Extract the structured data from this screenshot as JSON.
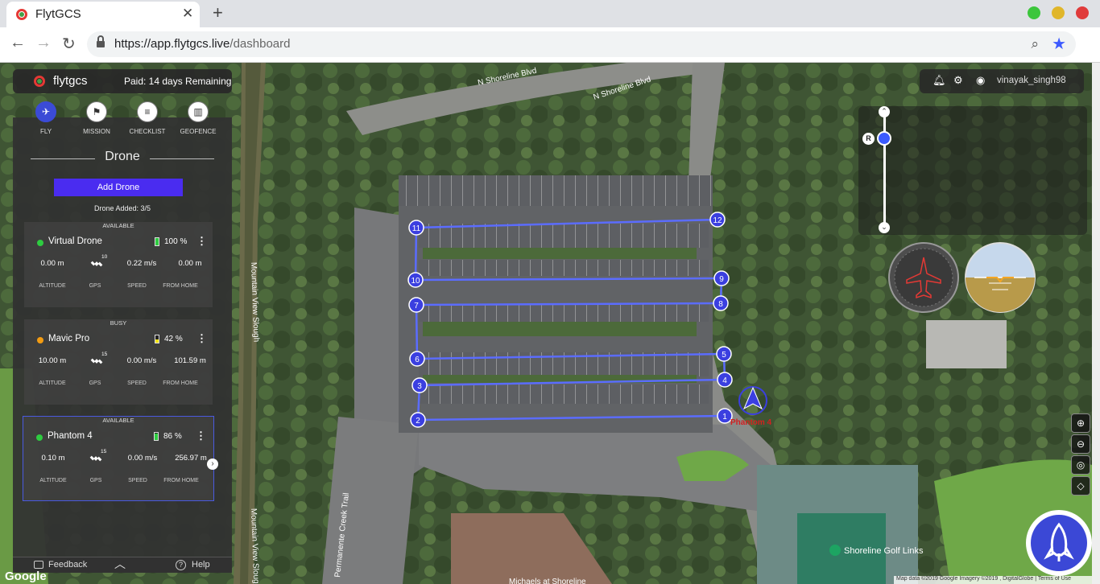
{
  "browser": {
    "tab_title": "FlytGCS",
    "tab_close": "✕",
    "new_tab": "+",
    "url_host": "https://app.flytgcs.live",
    "url_path": "/dashboard",
    "window_controls": [
      {
        "name": "maximize",
        "color": "#3cc63c"
      },
      {
        "name": "minimize",
        "color": "#e0b62a"
      },
      {
        "name": "close",
        "color": "#e03b3b"
      }
    ]
  },
  "brand": {
    "name": "flytgcs",
    "paid_text": "Paid: 14 days Remaining"
  },
  "modes": [
    {
      "label": "FLY",
      "icon": "plane-icon",
      "glyph": "✈",
      "active": true
    },
    {
      "label": "MISSION",
      "icon": "flag-icon",
      "glyph": "⚑",
      "active": false
    },
    {
      "label": "CHECKLIST",
      "icon": "checklist-icon",
      "glyph": "≡",
      "active": false
    },
    {
      "label": "GEOFENCE",
      "icon": "geofence-icon",
      "glyph": "▥",
      "active": false
    }
  ],
  "panel": {
    "heading": "Drone",
    "add_button": "Add Drone",
    "drone_count": "Drone Added: 3/5"
  },
  "stat_labels": {
    "altitude": "ALTITUDE",
    "gps": "GPS",
    "speed": "SPEED",
    "home": "FROM HOME"
  },
  "drones": [
    {
      "status": "AVAILABLE",
      "status_color": "#2ecc40",
      "name": "Virtual Drone",
      "battery": "100 %",
      "battery_level": 1.0,
      "battery_color": "#2ecc40",
      "altitude": "0.00 m",
      "gps": "10",
      "speed": "0.22 m/s",
      "home": "0.00 m",
      "selected": false
    },
    {
      "status": "BUSY",
      "status_color": "#f39c12",
      "name": "Mavic Pro",
      "battery": "42 %",
      "battery_level": 0.42,
      "battery_color": "#f1e20f",
      "altitude": "10.00 m",
      "gps": "15",
      "speed": "0.00 m/s",
      "home": "101.59 m",
      "selected": false
    },
    {
      "status": "AVAILABLE",
      "status_color": "#2ecc40",
      "name": "Phantom 4",
      "battery": "86 %",
      "battery_level": 0.86,
      "battery_color": "#2ecc40",
      "altitude": "0.10 m",
      "gps": "15",
      "speed": "0.00 m/s",
      "home": "256.97 m",
      "selected": true
    }
  ],
  "footer": {
    "feedback": "Feedback",
    "help": "Help"
  },
  "user": {
    "name": "vinayak_singh98"
  },
  "camera": {
    "reset_label": "R"
  },
  "map": {
    "streets": [
      "N Shoreline Blvd",
      "N Shoreline Blvd",
      "Mountain View Slough",
      "Mountain View Slough",
      "Permanente Creek Trail",
      "Michaels at Shoreline",
      "Shoreline Golf Links"
    ],
    "drone_label": "Phantom 4",
    "waypoints": [
      "1",
      "2",
      "3",
      "4",
      "5",
      "6",
      "7",
      "8",
      "9",
      "10",
      "11",
      "12"
    ],
    "google": "Google",
    "attribution": "Map data ©2019 Google Imagery ©2019 , DigitalGlobe | Terms of Use"
  },
  "colors": {
    "accent": "#4a2cf0",
    "waypoint": "#3b3fe0",
    "route": "#5b6cff"
  }
}
